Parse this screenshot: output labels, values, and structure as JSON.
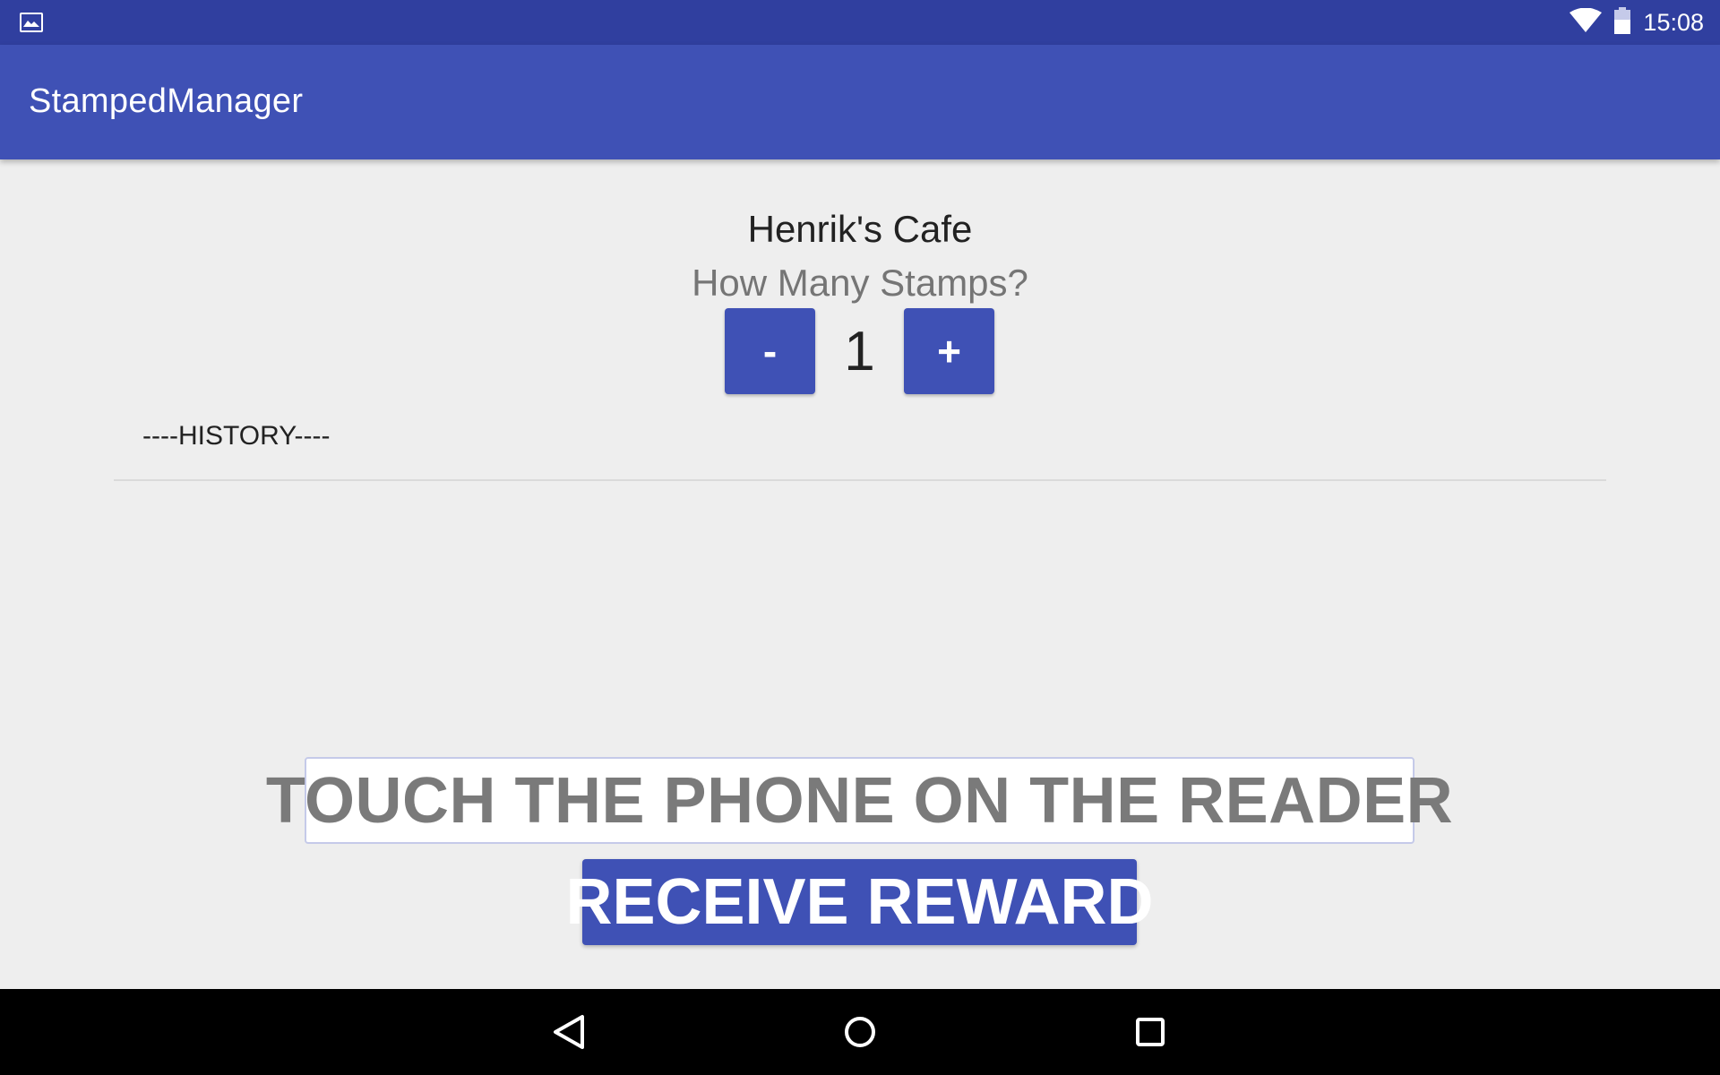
{
  "status_bar": {
    "time": "15:08",
    "icons": [
      "image-notification-icon",
      "wifi-icon",
      "battery-icon"
    ]
  },
  "app_bar": {
    "title": "StampedManager"
  },
  "main": {
    "cafe_name": "Henrik's Cafe",
    "stamps_prompt": "How Many Stamps?",
    "stepper": {
      "minus_label": "-",
      "value": "1",
      "plus_label": "+"
    },
    "history_label": "----HISTORY----",
    "touch_instruction": "TOUCH THE PHONE ON THE READER",
    "reward_button_label": "RECEIVE REWARD"
  },
  "nav_bar": {
    "icons": [
      "back-icon",
      "home-icon",
      "recents-icon"
    ]
  },
  "colors": {
    "status_bar": "#303f9f",
    "primary": "#3f51b5",
    "background": "#eeeeee"
  }
}
